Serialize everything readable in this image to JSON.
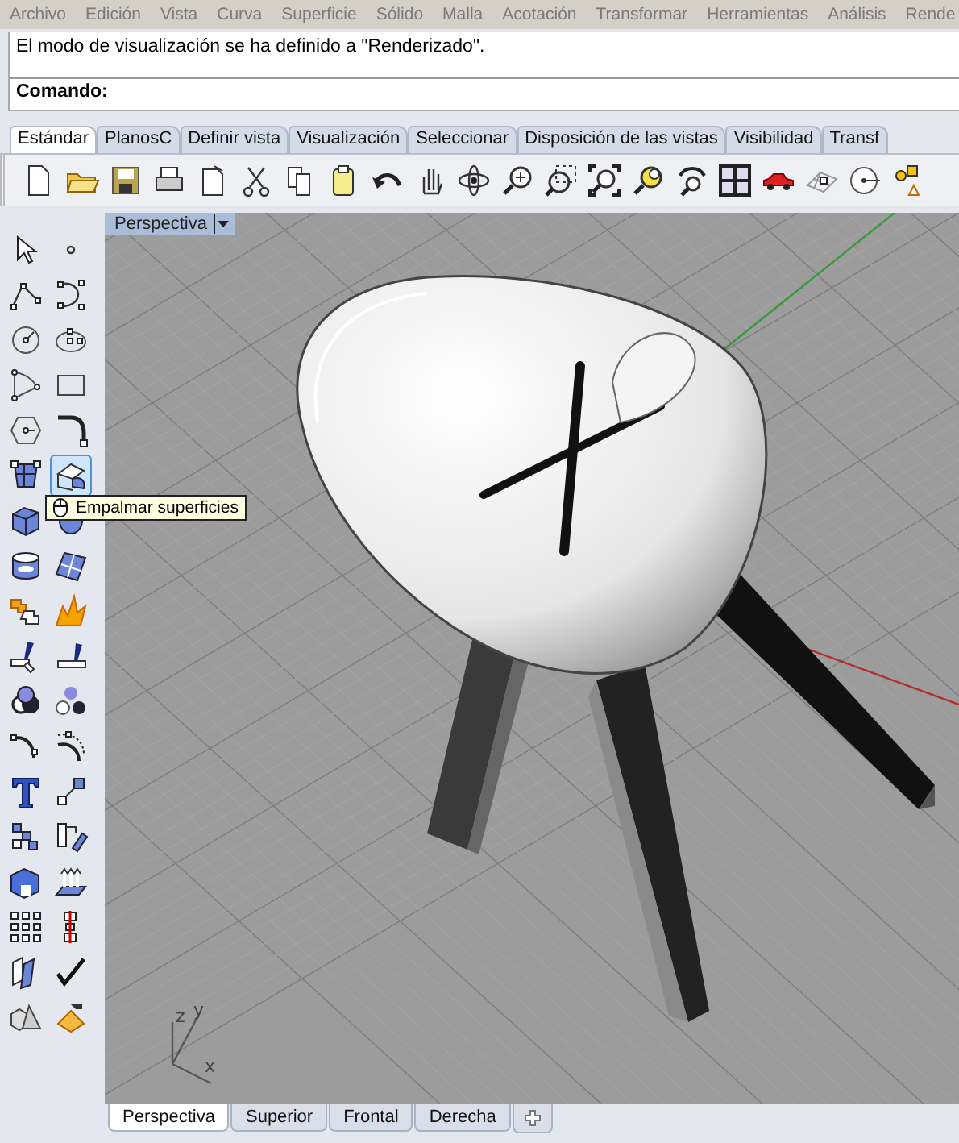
{
  "menu_bar": [
    "Archivo",
    "Edición",
    "Vista",
    "Curva",
    "Superficie",
    "Sólido",
    "Malla",
    "Acotación",
    "Transformar",
    "Herramientas",
    "Análisis",
    "Rende"
  ],
  "command_history": "El modo de visualización se ha definido a \"Renderizado\".",
  "command_prompt": {
    "label": "Comando:"
  },
  "toolbar_tabs": [
    {
      "label": "Estándar",
      "selected": true
    },
    {
      "label": "PlanosC",
      "selected": false
    },
    {
      "label": "Definir vista",
      "selected": false
    },
    {
      "label": "Visualización",
      "selected": false
    },
    {
      "label": "Seleccionar",
      "selected": false
    },
    {
      "label": "Disposición de las vistas",
      "selected": false
    },
    {
      "label": "Visibilidad",
      "selected": false
    },
    {
      "label": "Transf",
      "selected": false
    }
  ],
  "side_toolbar": {
    "buttons": [
      {
        "highlighted": false
      },
      {
        "highlighted": false
      },
      {
        "highlighted": false
      },
      {
        "highlighted": false
      },
      {
        "highlighted": false
      },
      {
        "highlighted": false
      },
      {
        "highlighted": false
      },
      {
        "highlighted": false
      },
      {
        "highlighted": false
      },
      {
        "highlighted": false
      },
      {
        "highlighted": false
      },
      {
        "highlighted": true
      },
      {
        "highlighted": false
      },
      {
        "highlighted": false
      },
      {
        "highlighted": false
      },
      {
        "highlighted": false
      },
      {
        "highlighted": false
      },
      {
        "highlighted": false
      },
      {
        "highlighted": false
      },
      {
        "highlighted": false
      },
      {
        "highlighted": false
      },
      {
        "highlighted": false
      },
      {
        "highlighted": false
      },
      {
        "highlighted": false
      },
      {
        "highlighted": false
      },
      {
        "highlighted": false
      },
      {
        "highlighted": false
      },
      {
        "highlighted": false
      },
      {
        "highlighted": false
      },
      {
        "highlighted": false
      },
      {
        "highlighted": false
      },
      {
        "highlighted": false
      },
      {
        "highlighted": false
      },
      {
        "highlighted": false
      },
      {
        "highlighted": false
      },
      {
        "highlighted": false
      }
    ],
    "tooltip": "Empalmar superficies"
  },
  "viewport": {
    "title": "Perspectiva",
    "axis_labels": {
      "z": "z",
      "y": "y",
      "x": "x"
    }
  },
  "viewport_tabs": [
    {
      "label": "Perspectiva",
      "selected": true
    },
    {
      "label": "Superior",
      "selected": false
    },
    {
      "label": "Frontal",
      "selected": false
    },
    {
      "label": "Derecha",
      "selected": false
    }
  ]
}
